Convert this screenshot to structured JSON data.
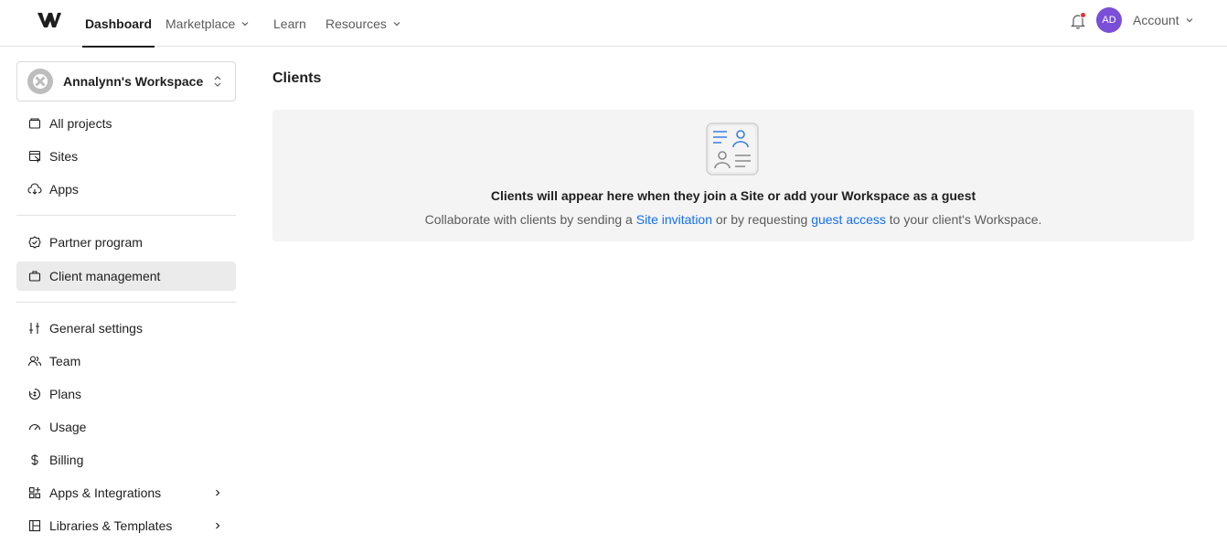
{
  "nav": {
    "brand_icon": "webflow-logo",
    "items": [
      {
        "label": "Dashboard",
        "active": true
      },
      {
        "label": "Marketplace",
        "has_dropdown": true
      },
      {
        "label": "Learn"
      },
      {
        "label": "Resources",
        "has_dropdown": true
      }
    ],
    "notification_icon": "bell-icon",
    "notification_dot_color": "#e0322b",
    "avatar_initials": "AD",
    "avatar_color": "#7b4ed8",
    "account_label": "Account"
  },
  "sidebar": {
    "workspace_name": "Annalynn's Workspace",
    "groups": [
      [
        {
          "label": "All projects",
          "icon": "folder-icon"
        },
        {
          "label": "Sites",
          "icon": "sites-icon"
        },
        {
          "label": "Apps",
          "icon": "cloud-apps-icon"
        }
      ],
      [
        {
          "label": "Partner program",
          "icon": "badge-check-icon"
        },
        {
          "label": "Client management",
          "icon": "briefcase-icon",
          "selected": true
        }
      ],
      [
        {
          "label": "General settings",
          "icon": "sliders-icon"
        },
        {
          "label": "Team",
          "icon": "team-icon"
        },
        {
          "label": "Plans",
          "icon": "plans-icon"
        },
        {
          "label": "Usage",
          "icon": "gauge-icon"
        },
        {
          "label": "Billing",
          "icon": "dollar-icon"
        },
        {
          "label": "Apps & Integrations",
          "icon": "grid-icon",
          "has_submenu": true
        },
        {
          "label": "Libraries & Templates",
          "icon": "library-icon",
          "has_submenu": true
        }
      ]
    ]
  },
  "main": {
    "title": "Clients",
    "empty_state": {
      "icon": "clients-contact-card-icon",
      "heading": "Clients will appear here when they join a Site or add your Workspace as a guest",
      "desc_part1": "Collaborate with clients by sending a ",
      "link1": "Site invitation",
      "desc_part2": " or by requesting ",
      "link2": "guest access",
      "desc_part3": " to your client's Workspace."
    }
  },
  "colors": {
    "accent_link": "#146ef5",
    "selected_bg": "#ebebeb",
    "card_bg": "#f4f4f4"
  }
}
